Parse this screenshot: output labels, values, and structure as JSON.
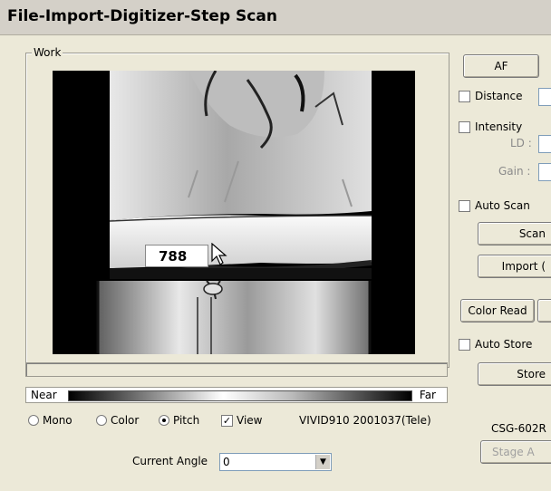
{
  "window": {
    "title": "File-Import-Digitizer-Step Scan"
  },
  "work": {
    "group_label": "Work",
    "readout": "788",
    "depth_scale": {
      "near": "Near",
      "far": "Far"
    }
  },
  "options": {
    "mono": "Mono",
    "color": "Color",
    "pitch": "Pitch",
    "view": "View",
    "selected_mode": "Pitch",
    "view_checked": true,
    "device": "VIVID910  2001037(Tele)"
  },
  "angle": {
    "label": "Current Angle",
    "value": "0"
  },
  "right_panel": {
    "af_button": "AF",
    "distance": "Distance",
    "intensity": "Intensity",
    "ld_label": "LD :",
    "gain_label": "Gain :",
    "auto_scan": "Auto Scan",
    "scan_button": "Scan",
    "import_button": "Import (",
    "color_read_button": "Color Read",
    "auto_store": "Auto Store",
    "store_button": "Store",
    "stage_model": "CSG-602R",
    "stage_button": "Stage A"
  }
}
